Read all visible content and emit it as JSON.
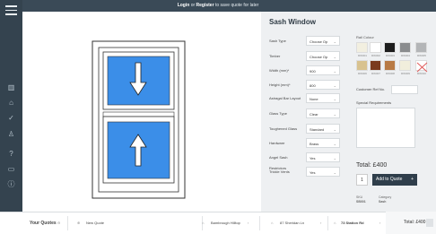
{
  "topbar": {
    "login": "Login",
    "or": "or",
    "register": "Register",
    "suffix": "to save quote for later"
  },
  "config": {
    "title": "Sash Window",
    "rows": [
      {
        "label": "Sash Type",
        "value": "Choose Op"
      },
      {
        "label": "Timber",
        "value": "Choose Op"
      },
      {
        "label": "Width (mm)*",
        "value": "900"
      },
      {
        "label": "Height (mm)*",
        "value": "800"
      },
      {
        "label": "Astragal Bar Layout",
        "value": "None"
      },
      {
        "label": "Glass Type",
        "value": "Clear"
      },
      {
        "label": "Toughened Glass",
        "value": "Standard"
      },
      {
        "label": "Hardware",
        "value": "Brass"
      },
      {
        "label": "Angel Sash Restrictors",
        "value": "Yes"
      },
      {
        "label": "Trickle Vents",
        "value": "Yes"
      }
    ]
  },
  "rail": {
    "title": "Rail Colour",
    "swatches": [
      {
        "label": "RW001",
        "color": "#f2efe0"
      },
      {
        "label": "RW002",
        "color": "#ffffff"
      },
      {
        "label": "RW003",
        "color": "#1d1d1d"
      },
      {
        "label": "RW004",
        "color": "#8a8c8e"
      },
      {
        "label": "RW005",
        "color": "#b3b5b7"
      },
      {
        "label": "RW006",
        "color": "#d8c28f"
      },
      {
        "label": "RW007",
        "color": "#7a3a1e"
      },
      {
        "label": "RW008",
        "color": "#b87a45"
      },
      {
        "label": "RW009",
        "color": "#f1eedc"
      },
      {
        "label": "RW010",
        "color": "none"
      }
    ]
  },
  "customer_ref_label": "Customer Ref No.",
  "special_req_label": "Special Requirements",
  "total_label": "Total: £400",
  "quantity": "1",
  "add_button": "Add to Quote",
  "sku": {
    "sku_label": "SKU",
    "sku_value": "SB001",
    "cat_label": "Category",
    "cat_value": "Sash"
  },
  "bottombar": {
    "your_quotes": "Your Quotes",
    "new_quote": "New Quote",
    "items": [
      "Bambrough Hilltop",
      "87 Sheridan Ln",
      "73 Station Rd"
    ],
    "total": "Total: £400"
  },
  "colors": {
    "nav": "#34434f",
    "glass": "#3b8ee8",
    "accent": "#2f3e4b"
  }
}
